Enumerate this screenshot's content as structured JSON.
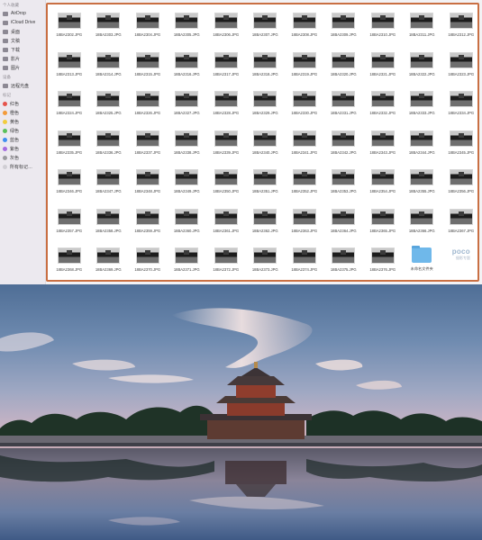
{
  "sidebar": {
    "section_personal": "个人收藏",
    "items": [
      {
        "label": "AirDrop",
        "icon": "airdrop-icon"
      },
      {
        "label": "iCloud Drive",
        "icon": "cloud-icon"
      },
      {
        "label": "桌面",
        "icon": "desktop-icon"
      },
      {
        "label": "文稿",
        "icon": "document-icon"
      },
      {
        "label": "下载",
        "icon": "download-icon"
      },
      {
        "label": "影片",
        "icon": "movie-icon"
      },
      {
        "label": "图片",
        "icon": "photo-icon"
      }
    ],
    "section_devices": "设备",
    "devices": [
      {
        "label": "远程光盘",
        "icon": "disc-icon"
      }
    ],
    "section_tags": "标记",
    "tags": [
      {
        "label": "红色",
        "color": "#e5534b"
      },
      {
        "label": "橙色",
        "color": "#f39b3a"
      },
      {
        "label": "黄色",
        "color": "#f2cc3d"
      },
      {
        "label": "绿色",
        "color": "#5ac05a"
      },
      {
        "label": "蓝色",
        "color": "#3f8ef0"
      },
      {
        "label": "紫色",
        "color": "#a56be0"
      },
      {
        "label": "灰色",
        "color": "#9b9b9f"
      },
      {
        "label": "所有标记…",
        "color": "#d0ced4"
      }
    ]
  },
  "files": [
    "18BA2302.JPG",
    "18BA2303.JPG",
    "18BA2304.JPG",
    "18BA2305.JPG",
    "18BA2306.JPG",
    "18BA2307.JPG",
    "18BA2308.JPG",
    "18BA2309.JPG",
    "18BA2310.JPG",
    "18BA2311.JPG",
    "18BA2312.JPG",
    "18BA2313.JPG",
    "18BA2314.JPG",
    "18BA2315.JPG",
    "18BA2316.JPG",
    "18BA2317.JPG",
    "18BA2318.JPG",
    "18BA2319.JPG",
    "18BA2320.JPG",
    "18BA2321.JPG",
    "18BA2322.JPG",
    "18BA2323.JPG",
    "18BA2324.JPG",
    "18BA2325.JPG",
    "18BA2326.JPG",
    "18BA2327.JPG",
    "18BA2328.JPG",
    "18BA2329.JPG",
    "18BA2330.JPG",
    "18BA2331.JPG",
    "18BA2332.JPG",
    "18BA2333.JPG",
    "18BA2334.JPG",
    "18BA2335.JPG",
    "18BA2336.JPG",
    "18BA2337.JPG",
    "18BA2338.JPG",
    "18BA2339.JPG",
    "18BA2340.JPG",
    "18BA2341.JPG",
    "18BA2342.JPG",
    "18BA2343.JPG",
    "18BA2344.JPG",
    "18BA2345.JPG",
    "18BA2346.JPG",
    "18BA2347.JPG",
    "18BA2348.JPG",
    "18BA2349.JPG",
    "18BA2350.JPG",
    "18BA2351.JPG",
    "18BA2352.JPG",
    "18BA2353.JPG",
    "18BA2354.JPG",
    "18BA2355.JPG",
    "18BA2356.JPG",
    "18BA2357.JPG",
    "18BA2358.JPG",
    "18BA2359.JPG",
    "18BA2360.JPG",
    "18BA2361.JPG",
    "18BA2362.JPG",
    "18BA2363.JPG",
    "18BA2364.JPG",
    "18BA2365.JPG",
    "18BA2366.JPG",
    "18BA2367.JPG",
    "18BA2368.JPG",
    "18BA2369.JPG",
    "18BA2370.JPG",
    "18BA2371.JPG",
    "18BA2372.JPG",
    "18BA2373.JPG",
    "18BA2374.JPG",
    "18BA2375.JPG",
    "18BA2376.JPG"
  ],
  "folder": {
    "label": "未命名文件夹",
    "icon": "folder-icon"
  },
  "watermark": {
    "main": "poco",
    "sub": "摄影专题"
  },
  "colors": {
    "selection_border": "#c96f43",
    "folder": "#6fb8ea"
  }
}
